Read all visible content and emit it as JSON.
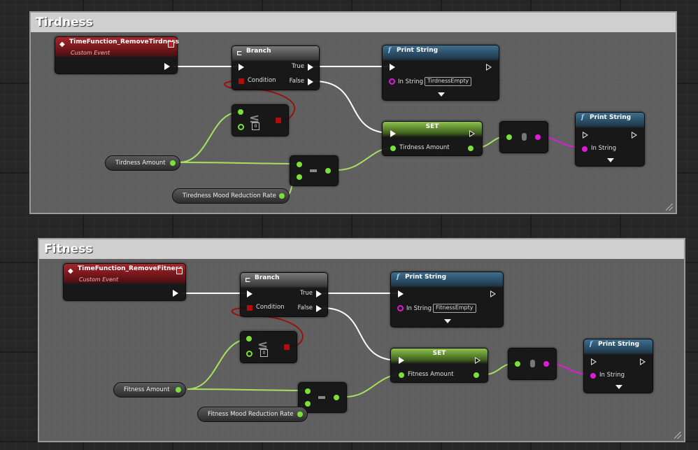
{
  "groups": [
    {
      "comment_title": "Tirdness",
      "event": {
        "name": "TimeFunction_RemoveTirdness",
        "subtitle": "Custom Event"
      },
      "branch": {
        "title": "Branch",
        "true_label": "True",
        "condition_label": "Condition",
        "false_label": "False"
      },
      "print_top": {
        "title": "Print String",
        "in_string_label": "In String",
        "in_string_value": "TirdnessEmpty"
      },
      "set": {
        "title": "SET",
        "pin_label": "Tirdness Amount"
      },
      "print_right": {
        "title": "Print String",
        "in_string_label": "In String"
      },
      "var_amount": "Tirdness Amount",
      "var_rate": "Tiredness Mood Reduction Rate"
    },
    {
      "comment_title": "Fitness",
      "event": {
        "name": "TimeFunction_RemoveFitness",
        "subtitle": "Custom Event"
      },
      "branch": {
        "title": "Branch",
        "true_label": "True",
        "condition_label": "Condition",
        "false_label": "False"
      },
      "print_top": {
        "title": "Print String",
        "in_string_label": "In String",
        "in_string_value": "FitnessEmpty"
      },
      "set": {
        "title": "SET",
        "pin_label": "Fitness Amount"
      },
      "print_right": {
        "title": "Print String",
        "in_string_label": "In String"
      },
      "var_amount": "Fitness Amount",
      "var_rate": "Fitness Mood Reduction Rate"
    }
  ],
  "colors": {
    "exec_wire": "#ffffff",
    "float_wire": "#a8e060",
    "string_wire": "#e01ad8",
    "bool_wire": "#9a1010",
    "event_header": "#a5262a",
    "function_header": "#3d6f8f",
    "set_header": "#8ec24c"
  },
  "icons": [
    "event-diamond-icon",
    "branch-icon",
    "function-icon",
    "exec-pin-icon",
    "dropdown-arrow-icon",
    "less-equal-icon",
    "subtract-icon",
    "conversion-icon"
  ]
}
